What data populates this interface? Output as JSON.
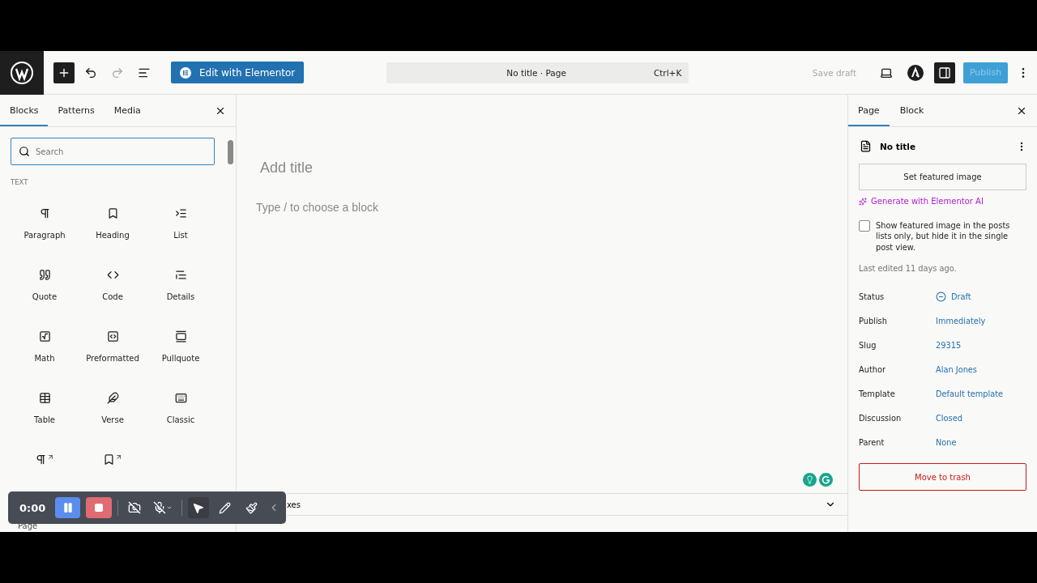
{
  "topbar": {
    "edit_button": "Edit with Elementor",
    "command": {
      "title": "No title · Page",
      "shortcut": "Ctrl+K"
    },
    "save_draft": "Save draft",
    "settings_open": true,
    "publish": "Publish"
  },
  "inserter": {
    "tabs": [
      {
        "label": "Blocks",
        "selected": true
      },
      {
        "label": "Patterns",
        "selected": false
      },
      {
        "label": "Media",
        "selected": false
      }
    ],
    "search": {
      "placeholder": "Search"
    },
    "category": "TEXT",
    "blocks": [
      {
        "kind": "paragraph",
        "label": "Paragraph"
      },
      {
        "kind": "heading",
        "label": "Heading"
      },
      {
        "kind": "list",
        "label": "List"
      },
      {
        "kind": "quote",
        "label": "Quote"
      },
      {
        "kind": "code",
        "label": "Code"
      },
      {
        "kind": "details",
        "label": "Details"
      },
      {
        "kind": "math",
        "label": "Math"
      },
      {
        "kind": "preformatted",
        "label": "Preformatted"
      },
      {
        "kind": "pullquote",
        "label": "Pullquote"
      },
      {
        "kind": "table",
        "label": "Table"
      },
      {
        "kind": "verse",
        "label": "Verse"
      },
      {
        "kind": "classic",
        "label": "Classic"
      },
      {
        "kind": "paragraph-link"
      },
      {
        "kind": "heading-link"
      }
    ],
    "breadcrumb": "Page"
  },
  "editor": {
    "title_placeholder": "Add title",
    "block_placeholder": "Type / to choose a block",
    "meta_boxes": "xes"
  },
  "sidebar": {
    "tabs": [
      {
        "label": "Page",
        "selected": true
      },
      {
        "label": "Block",
        "selected": false
      }
    ],
    "document_title": "No title",
    "featured_button": "Set featured image",
    "ai_link": "Generate with Elementor AI",
    "checkbox": {
      "label": "Show featured image in the posts lists only, but hide it in the single post view.",
      "checked": false
    },
    "last_edited": "Last edited 11 days ago.",
    "fields": [
      {
        "label": "Status",
        "value": "Draft",
        "kind": "status"
      },
      {
        "label": "Publish",
        "value": "Immediately"
      },
      {
        "label": "Slug",
        "value": "29315"
      },
      {
        "label": "Author",
        "value": "Alan Jones"
      },
      {
        "label": "Template",
        "value": "Default template"
      },
      {
        "label": "Discussion",
        "value": "Closed"
      },
      {
        "label": "Parent",
        "value": "None"
      }
    ],
    "trash_button": "Move to trash"
  },
  "recorder": {
    "time": "0:00",
    "tools": [
      {
        "kind": "pointer",
        "selected": true
      },
      {
        "kind": "pen",
        "selected": false
      },
      {
        "kind": "brush",
        "selected": false
      }
    ]
  }
}
